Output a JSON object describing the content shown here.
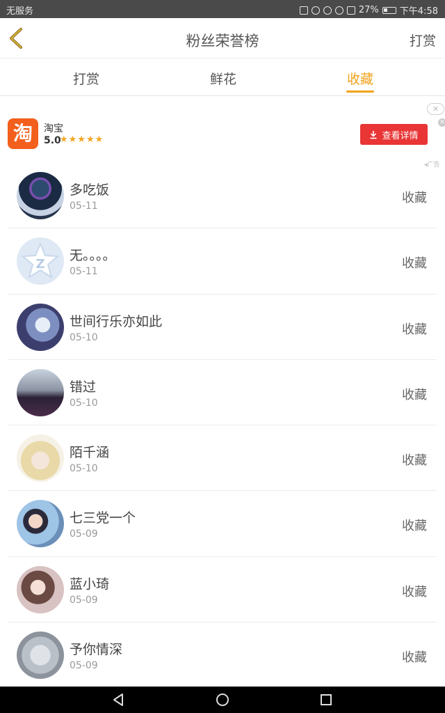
{
  "status_bar": {
    "carrier": "无服务",
    "battery": "27%",
    "time": "下午4:58"
  },
  "header": {
    "title": "粉丝荣誉榜",
    "action_label": "打赏",
    "back_icon": "chevron-left-icon"
  },
  "tabs": [
    {
      "label": "打赏",
      "active": false
    },
    {
      "label": "鲜花",
      "active": false
    },
    {
      "label": "收藏",
      "active": true
    }
  ],
  "ad": {
    "app_name": "淘宝",
    "logo_char": "淘",
    "rating": "5.0",
    "stars": "★★★★★",
    "button_label": "查看详情",
    "ad_label": "广告"
  },
  "list": [
    {
      "name": "多吃饭",
      "date": "05-11",
      "status": "收藏"
    },
    {
      "name": "无。。。。",
      "date": "05-11",
      "status": "收藏"
    },
    {
      "name": "世间行乐亦如此",
      "date": "05-10",
      "status": "收藏"
    },
    {
      "name": "错过",
      "date": "05-10",
      "status": "收藏"
    },
    {
      "name": "陌千涵",
      "date": "05-10",
      "status": "收藏"
    },
    {
      "name": "七三党一个",
      "date": "05-09",
      "status": "收藏"
    },
    {
      "name": "蓝小琦",
      "date": "05-09",
      "status": "收藏"
    },
    {
      "name": "予你情深",
      "date": "05-09",
      "status": "收藏"
    }
  ],
  "colors": {
    "accent": "#f0a21b",
    "ad_button": "#e93535",
    "taobao": "#f35f1c"
  }
}
